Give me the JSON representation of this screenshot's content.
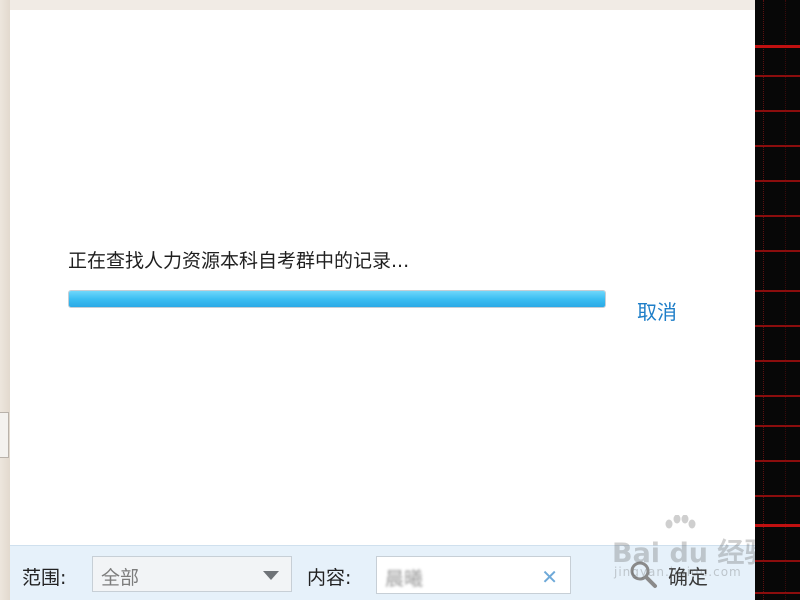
{
  "search_dialog": {
    "status_text": "正在查找人力资源本科自考群中的记录...",
    "progress": 1.0,
    "cancel_label": "取消"
  },
  "bottom_bar": {
    "scope_label": "范围:",
    "scope_value": "全部",
    "content_label": "内容:",
    "content_value": "晨曦",
    "clear_icon": "✕",
    "search_icon": "search-icon",
    "confirm_label": "确定"
  },
  "watermark": {
    "brand": "Bai du 经验",
    "url": "jingyan.baidu.com"
  },
  "colors": {
    "progress_fill": "#3cbef2",
    "link": "#1e7ec8",
    "bottom_bar_bg": "#e6f1fa",
    "side_panel_bg": "#070707",
    "side_panel_lines": "#8b0d0d"
  }
}
